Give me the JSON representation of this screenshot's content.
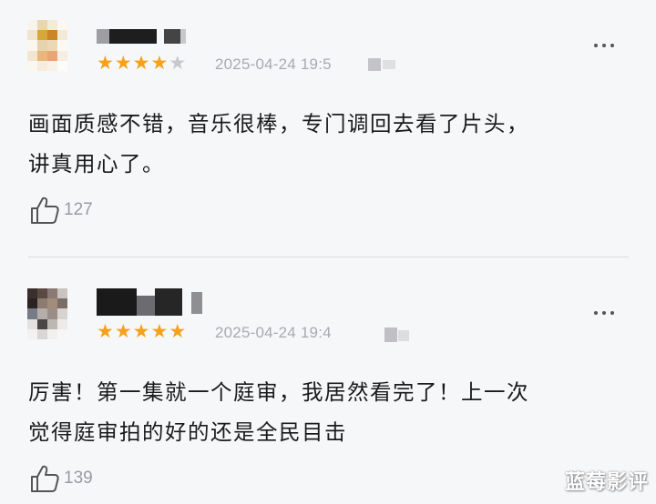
{
  "reviews": [
    {
      "rating_text": "★★★★★",
      "rating": 4,
      "max_rating": 5,
      "date": "2025-04-24 19:5",
      "content_line1": "画面质感不错，音乐很棒，专门调回去看了片头，",
      "content_line2": "讲真用心了。",
      "likes": "127",
      "more_icon": "more-dots-icon",
      "like_icon": "thumbs-up-icon"
    },
    {
      "rating_text": "★★★★★",
      "rating": 5,
      "max_rating": 5,
      "date": "2025-04-24 19:4",
      "content_line1": "厉害！第一集就一个庭审，我居然看完了！上一次",
      "content_line2": "觉得庭审拍的好的还是全民目击",
      "likes": "139",
      "more_icon": "more-dots-icon",
      "like_icon": "thumbs-up-icon"
    }
  ],
  "watermark": "蓝莓影评",
  "colors": {
    "star_filled": "#f6a11a",
    "star_empty": "#c8c8cc",
    "background": "#f6f7f9",
    "text": "#1b1b1b",
    "muted": "#a9a9b0"
  }
}
